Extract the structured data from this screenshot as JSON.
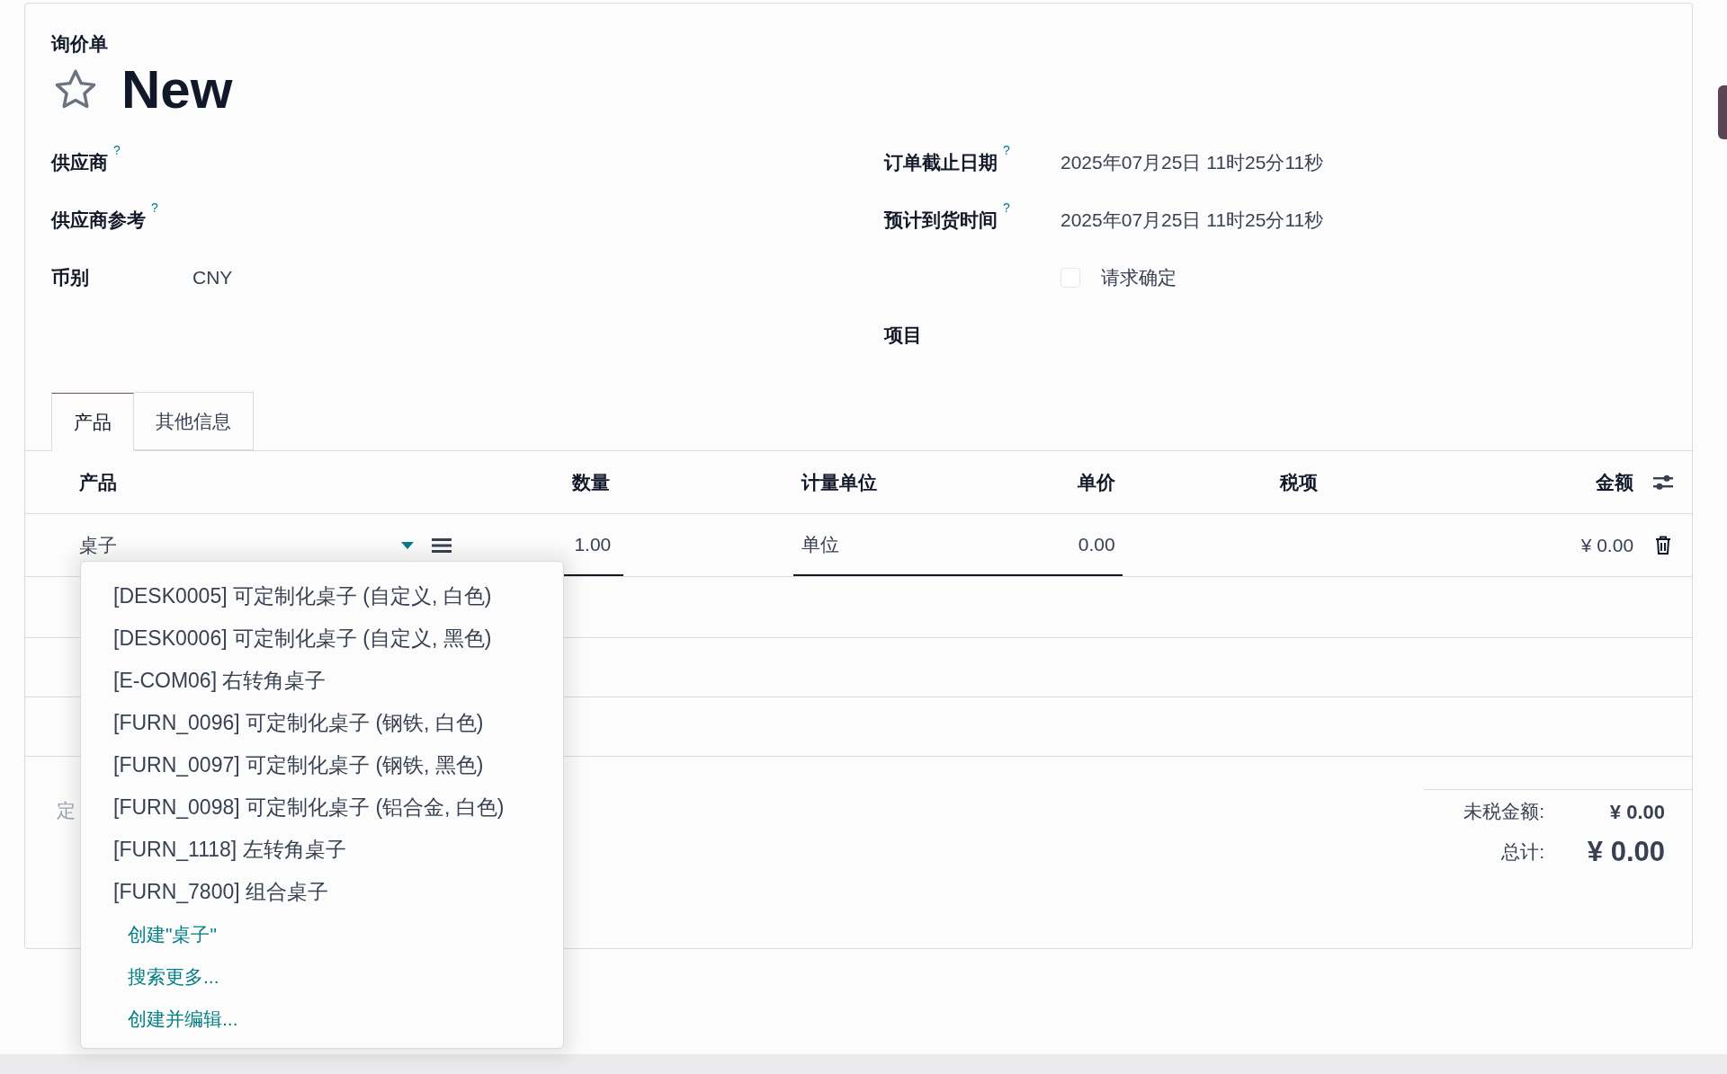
{
  "breadcrumb": "询价单",
  "title": "New",
  "favorite": false,
  "left_fields": [
    {
      "label": "供应商",
      "help": "?"
    },
    {
      "label": "供应商参考",
      "help": "?"
    },
    {
      "label": "币别",
      "value": "CNY"
    }
  ],
  "right_fields": [
    {
      "kind": "text",
      "label": "订单截止日期",
      "help": "?",
      "value": "2025年07月25日 11时25分11秒"
    },
    {
      "kind": "text",
      "label": "预计到货时间",
      "help": "?",
      "value": "2025年07月25日 11时25分11秒"
    },
    {
      "kind": "checkbox",
      "label": "请求确定",
      "checked": false
    },
    {
      "kind": "text",
      "label": "项目"
    }
  ],
  "tabs": [
    {
      "label": "产品",
      "selected": true
    },
    {
      "label": "其他信息",
      "selected": false
    }
  ],
  "table": {
    "columns": [
      "产品",
      "数量",
      "计量单位",
      "单价",
      "税项",
      "金额"
    ],
    "rows": [
      {
        "product": "桌子",
        "quantity": "1.00",
        "uom": "单位",
        "unit_price": "0.00",
        "amount": "¥ 0.00"
      }
    ]
  },
  "note_placeholder": "定",
  "totals": [
    {
      "kind": "subtotal",
      "label": "未税金额:",
      "value": "¥ 0.00"
    },
    {
      "kind": "total",
      "label": "总计:",
      "value": "¥ 0.00"
    }
  ],
  "dropdown": {
    "items": [
      "[DESK0005] 可定制化桌子 (自定义, 白色)",
      "[DESK0006] 可定制化桌子 (自定义, 黑色)",
      "[E-COM06] 右转角桌子",
      "[FURN_0096] 可定制化桌子 (钢铁, 白色)",
      "[FURN_0097] 可定制化桌子 (钢铁, 黑色)",
      "[FURN_0098] 可定制化桌子 (铝合金, 白色)",
      "[FURN_1118] 左转角桌子",
      "[FURN_7800] 组合桌子"
    ],
    "actions": [
      "创建\"桌子\"",
      "搜索更多...",
      "创建并编辑..."
    ]
  }
}
